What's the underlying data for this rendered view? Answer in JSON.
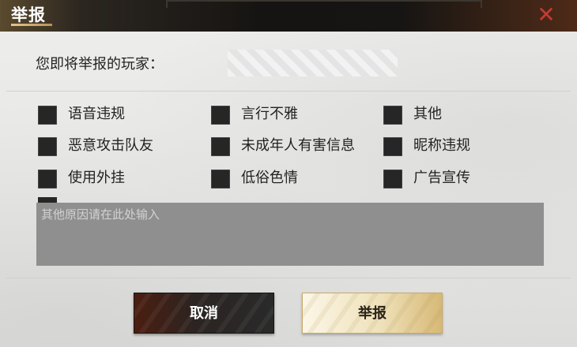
{
  "dialog": {
    "title": "举报",
    "close_symbol": "✕"
  },
  "target": {
    "label": "您即将举报的玩家：",
    "name": ""
  },
  "reasons": [
    {
      "label": "语音违规"
    },
    {
      "label": "言行不雅"
    },
    {
      "label": "其他"
    },
    {
      "label": "恶意攻击队友"
    },
    {
      "label": "未成年人有害信息"
    },
    {
      "label": "昵称违规"
    },
    {
      "label": "使用外挂"
    },
    {
      "label": "低俗色情"
    },
    {
      "label": "广告宣传"
    }
  ],
  "other_reason": {
    "placeholder": "其他原因请在此处输入",
    "value": ""
  },
  "buttons": {
    "cancel": "取消",
    "confirm": "举报"
  },
  "colors": {
    "close_red": "#c43a32",
    "title_accent_gold": "#d8b878",
    "checkbox_dark": "#262626",
    "confirm_gold": "#efe2bb"
  }
}
